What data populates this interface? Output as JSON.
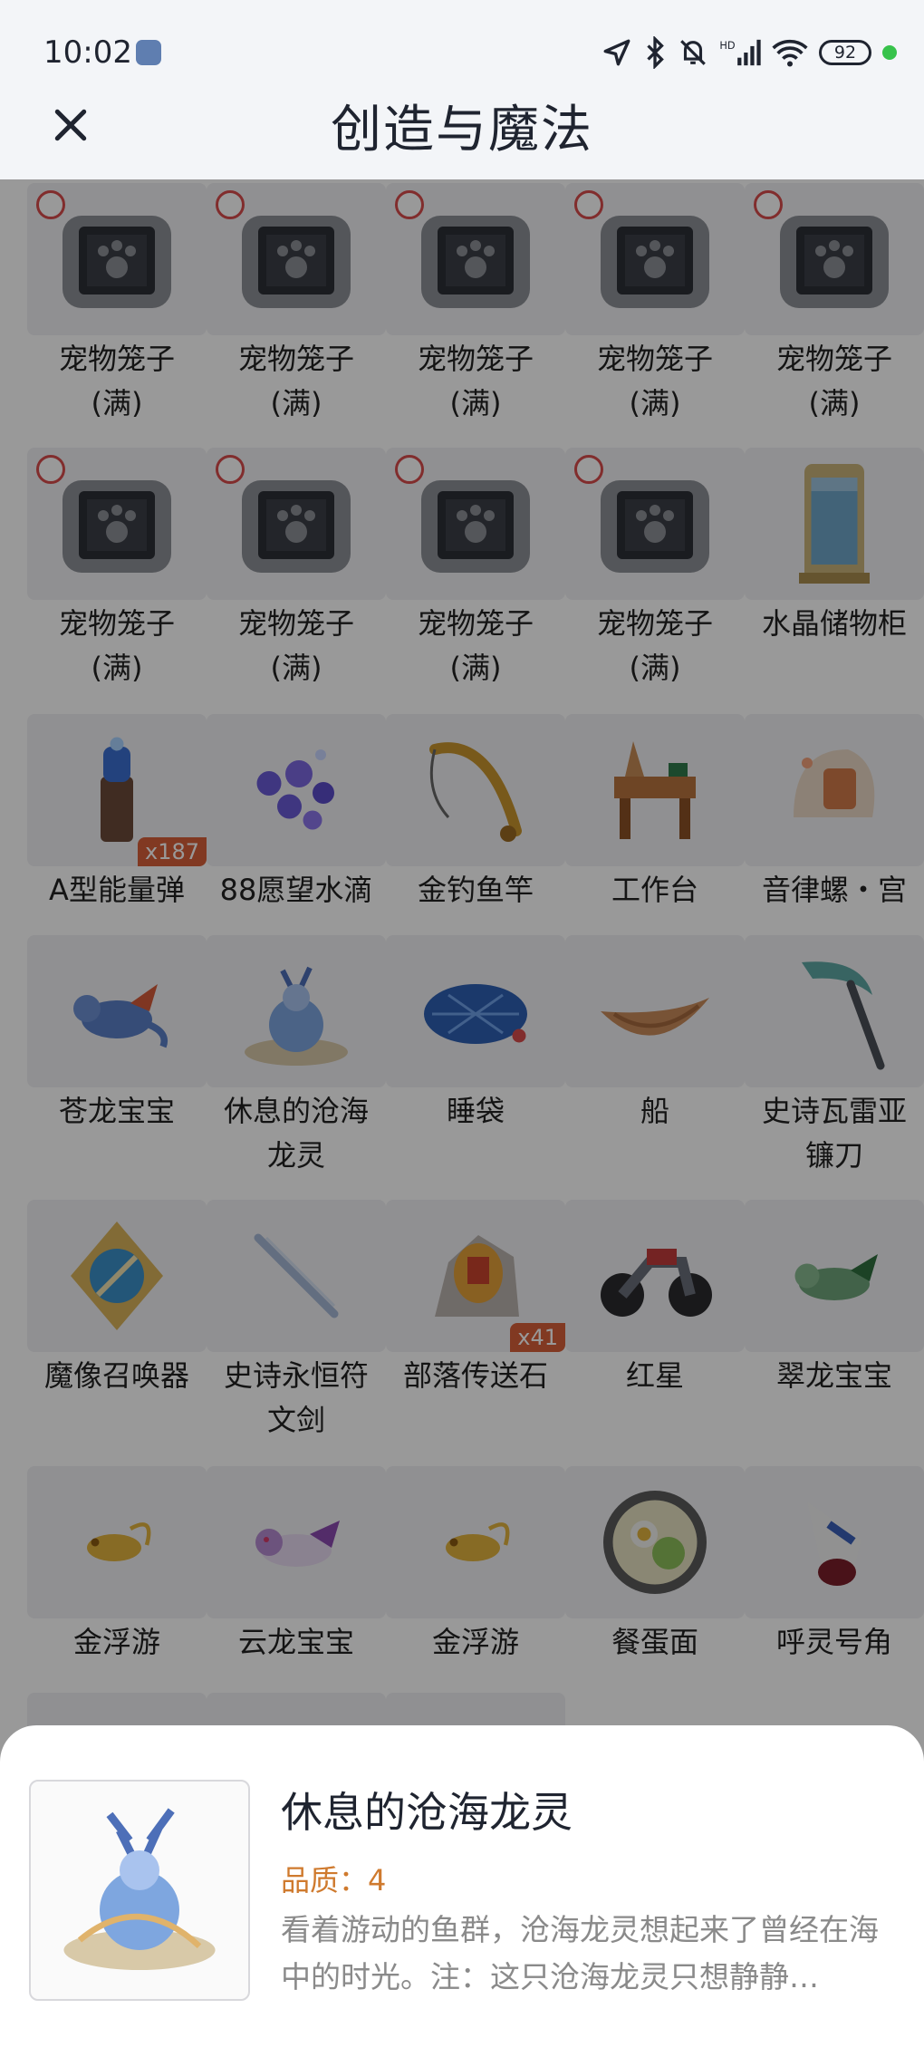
{
  "status_bar": {
    "time": "10:02",
    "battery": "92"
  },
  "header": {
    "title": "创造与魔法",
    "close_icon": "close-icon"
  },
  "items": [
    {
      "name": "宠物笼子",
      "name2": "(满)",
      "icon": "pet-cage-icon"
    },
    {
      "name": "宠物笼子",
      "name2": "(满)",
      "icon": "pet-cage-icon"
    },
    {
      "name": "宠物笼子",
      "name2": "(满)",
      "icon": "pet-cage-icon"
    },
    {
      "name": "宠物笼子",
      "name2": "(满)",
      "icon": "pet-cage-icon"
    },
    {
      "name": "宠物笼子",
      "name2": "(满)",
      "icon": "pet-cage-icon"
    },
    {
      "name": "宠物笼子",
      "name2": "(满)",
      "icon": "pet-cage-icon"
    },
    {
      "name": "宠物笼子",
      "name2": "(满)",
      "icon": "pet-cage-icon"
    },
    {
      "name": "宠物笼子",
      "name2": "(满)",
      "icon": "pet-cage-icon"
    },
    {
      "name": "宠物笼子",
      "name2": "(满)",
      "icon": "pet-cage-icon"
    },
    {
      "name": "水晶储物柜",
      "name2": "",
      "icon": "crystal-cabinet-icon"
    },
    {
      "name": "A型能量弹",
      "name2": "",
      "icon": "energy-shell-icon",
      "badge": "x187"
    },
    {
      "name": "88愿望水滴",
      "name2": "",
      "icon": "wish-drop-icon"
    },
    {
      "name": "金钓鱼竿",
      "name2": "",
      "icon": "fishing-rod-icon"
    },
    {
      "name": "工作台",
      "name2": "",
      "icon": "workbench-icon"
    },
    {
      "name": "音律螺・宫",
      "name2": "",
      "icon": "conch-icon"
    },
    {
      "name": "苍龙宝宝",
      "name2": "",
      "icon": "dragon-baby-icon"
    },
    {
      "name": "休息的沧海",
      "name2": "龙灵",
      "icon": "sea-dragon-icon"
    },
    {
      "name": "睡袋",
      "name2": "",
      "icon": "sleeping-bag-icon"
    },
    {
      "name": "船",
      "name2": "",
      "icon": "boat-icon"
    },
    {
      "name": "史诗瓦雷亚",
      "name2": "镰刀",
      "icon": "scythe-icon"
    },
    {
      "name": "魔像召唤器",
      "name2": "",
      "icon": "golem-summoner-icon"
    },
    {
      "name": "史诗永恒符",
      "name2": "文剑",
      "icon": "rune-sword-icon"
    },
    {
      "name": "部落传送石",
      "name2": "",
      "icon": "teleport-stone-icon",
      "badge": "x41"
    },
    {
      "name": "红星",
      "name2": "",
      "icon": "motorcycle-icon"
    },
    {
      "name": "翠龙宝宝",
      "name2": "",
      "icon": "jade-dragon-icon"
    },
    {
      "name": "金浮游",
      "name2": "",
      "icon": "gold-floater-icon"
    },
    {
      "name": "云龙宝宝",
      "name2": "",
      "icon": "cloud-dragon-icon"
    },
    {
      "name": "金浮游",
      "name2": "",
      "icon": "gold-floater-icon"
    },
    {
      "name": "餐蛋面",
      "name2": "",
      "icon": "noodle-bowl-icon"
    },
    {
      "name": "呼灵号角",
      "name2": "",
      "icon": "horn-icon"
    }
  ],
  "detail": {
    "name": "休息的沧海龙灵",
    "quality": "品质：4",
    "description": "看着游动的鱼群，沧海龙灵想起来了曾经在海中的时光。注：这只沧海龙灵只想静静…",
    "icon": "sea-dragon-icon"
  },
  "colors": {
    "badge": "#d8603a",
    "quality": "#cf7a2e",
    "dim": "rgba(0,0,0,0.40)"
  }
}
